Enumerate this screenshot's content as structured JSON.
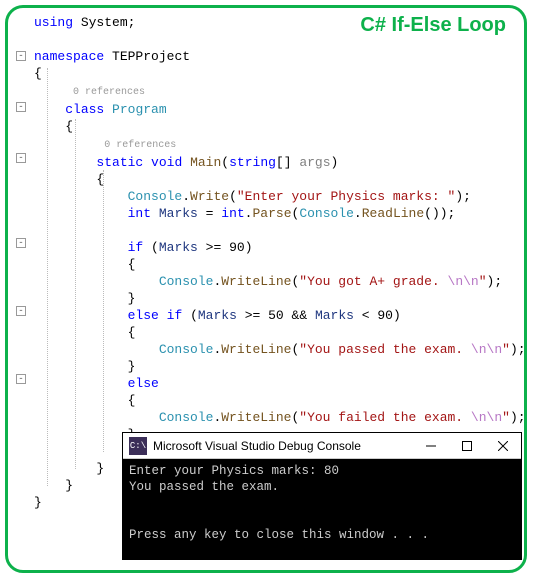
{
  "heading": "C# If-Else Loop",
  "code": {
    "t0": "using",
    "t1": "System",
    "t2": "namespace",
    "t3": "TEPProject",
    "ref": "0 references",
    "t4": "class",
    "t5": "Program",
    "t6": "static",
    "t7": "void",
    "t8": "Main",
    "t9": "string",
    "t10": "args",
    "console": "Console",
    "write": "Write",
    "writeline": "WriteLine",
    "readline": "ReadLine",
    "parse": "Parse",
    "int": "int",
    "marks": "Marks",
    "if": "if",
    "else": "else",
    "n90": "90",
    "n50": "50",
    "nn": "\\n\\n",
    "s1": "\"Enter your Physics marks: \"",
    "s2a": "\"You got A+ grade. ",
    "s3a": "\"You passed the exam. ",
    "s4a": "\"You failed the exam. "
  },
  "consoleWin": {
    "title": "Microsoft Visual Studio Debug Console",
    "line1": "Enter your Physics marks: 80",
    "line2": "You passed the exam.",
    "line3": "Press any key to close this window . . ."
  }
}
